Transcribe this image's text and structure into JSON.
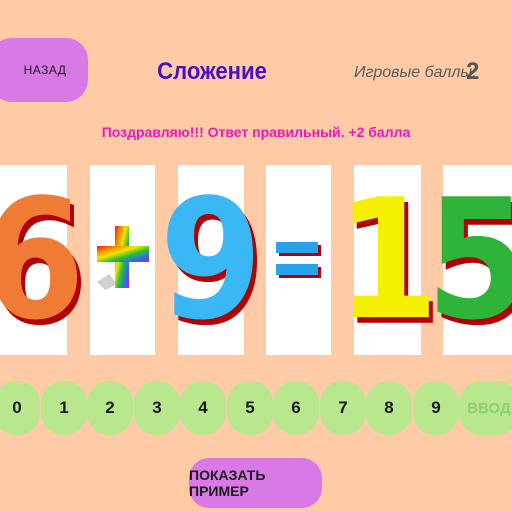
{
  "header": {
    "back_label": "НАЗАД",
    "title": "Сложение",
    "score_label": "Игровые баллы:",
    "score_value": "2"
  },
  "message": "Поздравляю!!! Ответ правильный. +2 балла",
  "equation": [
    {
      "kind": "digit",
      "value": "6",
      "color": "#f07b35"
    },
    {
      "kind": "operator",
      "value": "+",
      "icon": "rainbow-plus-icon"
    },
    {
      "kind": "digit",
      "value": "9",
      "color": "#3ab8f5"
    },
    {
      "kind": "operator",
      "value": "=",
      "icon": "equals-icon",
      "color": "#2aa2ea"
    },
    {
      "kind": "digit",
      "value": "1",
      "color": "#f5f000"
    },
    {
      "kind": "digit",
      "value": "5",
      "color": "#2fb43a"
    }
  ],
  "keypad": {
    "digits": [
      "0",
      "1",
      "2",
      "3",
      "4",
      "5",
      "6",
      "7",
      "8",
      "9"
    ],
    "enter_label": "ВВОД"
  },
  "show_example_label": "ПОКАЗАТЬ ПРИМЕР",
  "colors": {
    "background": "#ffcba6",
    "button": "#d879e6",
    "key": "#b8e78e",
    "title": "#4a10c8",
    "message": "#ef18b8",
    "shadow": "#b30000"
  }
}
